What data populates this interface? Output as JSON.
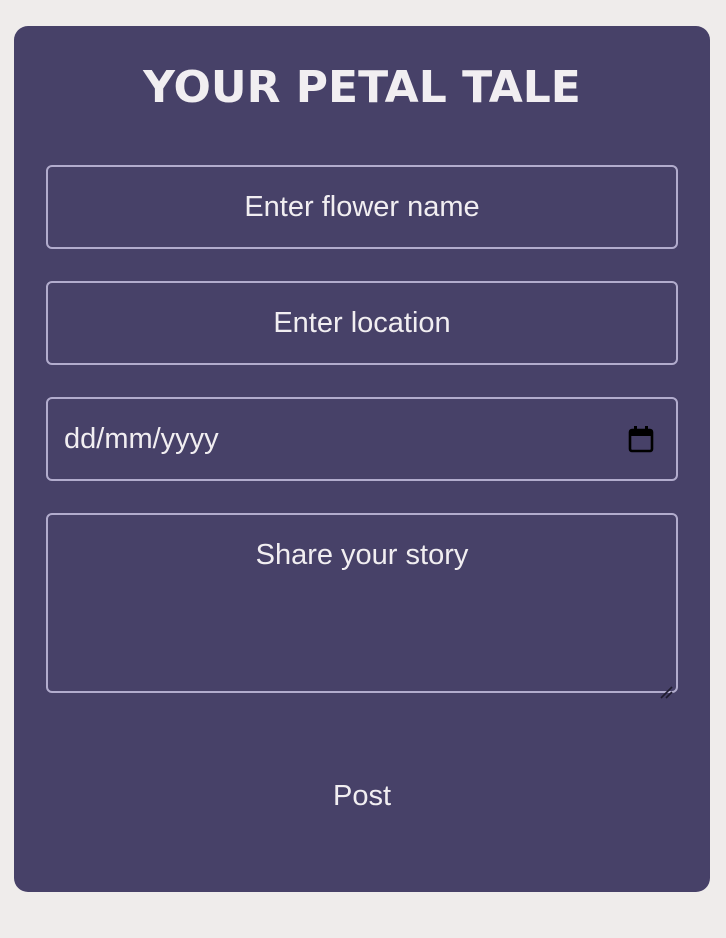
{
  "form": {
    "title": "YOUR PETAL TALE",
    "flower_name_placeholder": "Enter flower name",
    "location_placeholder": "Enter location",
    "date_placeholder": "dd/mm/yyyy",
    "date_icon": "calendar-icon",
    "story_placeholder": "Share your story",
    "post_label": "Post"
  },
  "colors": {
    "page_background": "#efeceb",
    "card_background": "#474168",
    "field_border": "#b2accd",
    "text": "#f1eef1"
  }
}
